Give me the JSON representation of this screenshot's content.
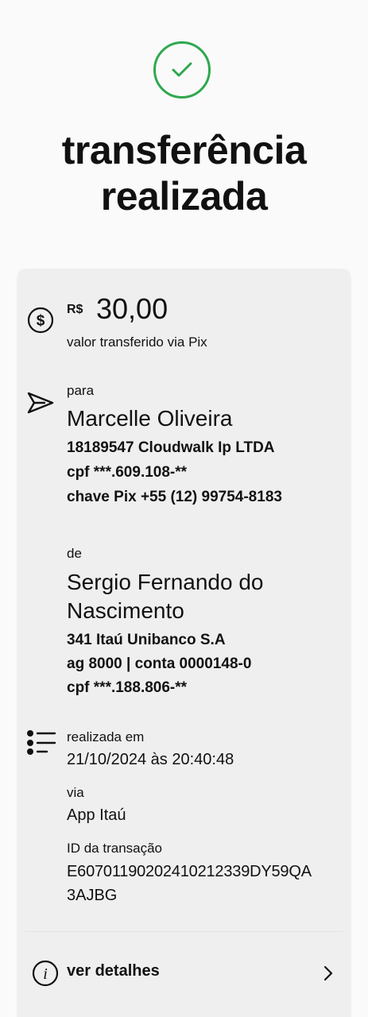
{
  "header": {
    "title_line1": "transferência",
    "title_line2": "realizada",
    "check_icon": "check-circle-icon",
    "accent_color": "#2fa84f"
  },
  "amount": {
    "currency": "R$",
    "value": "30,00",
    "caption": "valor transferido via Pix",
    "icon": "dollar-circle-icon"
  },
  "recipient": {
    "label": "para",
    "name": "Marcelle Oliveira",
    "institution": "18189547 Cloudwalk Ip LTDA",
    "cpf": "cpf ***.609.108-**",
    "pix_key": "chave Pix +55 (12) 99754-8183",
    "icon": "send-icon"
  },
  "sender": {
    "label": "de",
    "name_line1": "Sergio Fernando do",
    "name_line2": "Nascimento",
    "bank": "341 Itaú Unibanco S.A",
    "account": "ag 8000 | conta 0000148-0",
    "cpf": "cpf ***.188.806-**"
  },
  "details": {
    "icon": "list-icon",
    "date_label": "realizada em",
    "date_value": "21/10/2024 às 20:40:48",
    "via_label": "via",
    "via_value": "App Itaú",
    "id_label": "ID da transação",
    "id_line1": "E6070119020241021233​9DY59QA",
    "id_line2": "3AJBG"
  },
  "footer": {
    "details_label": "ver detalhes",
    "info_icon": "info-icon",
    "chevron_icon": "chevron-right-icon"
  }
}
